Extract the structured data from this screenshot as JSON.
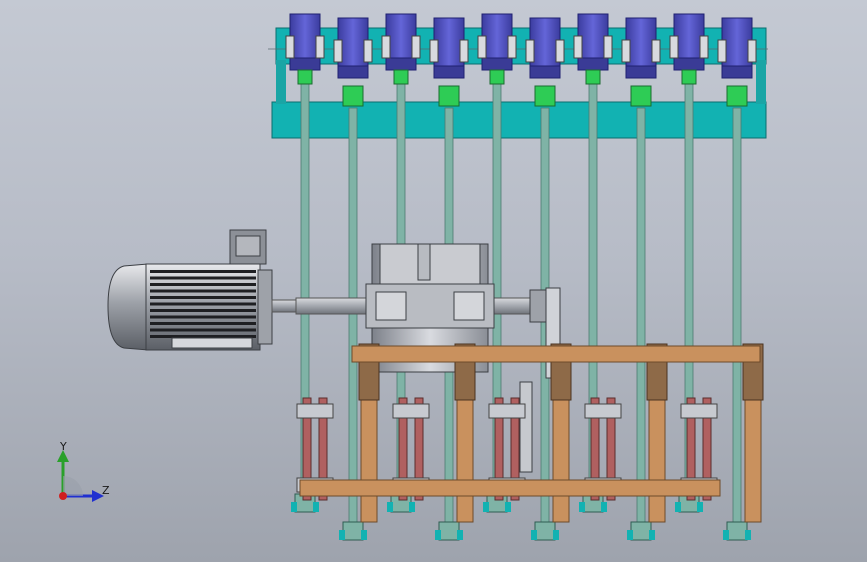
{
  "view": {
    "background_top": "#c4c9d3",
    "background_bottom": "#9ea3ad"
  },
  "triad": {
    "y_label": "Y",
    "z_label": "Z",
    "y_color": "#2aa02a",
    "z_color": "#2030d0",
    "x_color": "#d02020"
  },
  "model": {
    "actuator_count": 10,
    "colors": {
      "frame": "#12b2b2",
      "actuator": "#4e4fc0",
      "coupling": "#2ecc55",
      "rod": "#7fb3a6",
      "motor": "#9da1a8",
      "link_brown": "#c9915e",
      "link_red": "#b06060",
      "roller": "#b07a4a"
    }
  }
}
